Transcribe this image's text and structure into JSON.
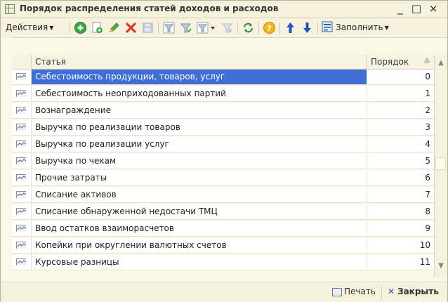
{
  "window": {
    "title": "Порядок распределения статей доходов и расходов",
    "minimize": "_",
    "maximize": "□",
    "close": "×"
  },
  "toolbar": {
    "actions_label": "Действия",
    "fill_label": "Заполнить"
  },
  "table": {
    "headers": {
      "name": "Статья",
      "order": "Порядок"
    },
    "sort_indicator": "≙",
    "rows": [
      {
        "name": "Себестоимость продукции, товаров, услуг",
        "order": "0",
        "selected": true
      },
      {
        "name": "Себестоимость неоприходованных партий",
        "order": "1"
      },
      {
        "name": "Вознаграждение",
        "order": "2"
      },
      {
        "name": "Выручка по реализации товаров",
        "order": "3"
      },
      {
        "name": "Выручка по реализации услуг",
        "order": "4"
      },
      {
        "name": "Выручка по чекам",
        "order": "5"
      },
      {
        "name": "Прочие затраты",
        "order": "6"
      },
      {
        "name": "Списание активов",
        "order": "7"
      },
      {
        "name": "Списание обнаруженной недостачи ТМЦ",
        "order": "8"
      },
      {
        "name": "Ввод остатков взаиморасчетов",
        "order": "9"
      },
      {
        "name": "Копейки при округлении валютных счетов",
        "order": "10"
      },
      {
        "name": "Курсовые разницы",
        "order": "11"
      }
    ]
  },
  "footer": {
    "print_label": "Печать",
    "close_label": "Закрыть"
  },
  "colors": {
    "selection": "#3f6fd4",
    "background": "#fbf7e7",
    "toolbar": "#f7f2dd"
  },
  "icons": [
    "add-icon",
    "copy-icon",
    "edit-icon",
    "delete-icon",
    "save-icon",
    "filter-icon",
    "refresh-icon",
    "help-icon",
    "move-up-icon",
    "move-down-icon",
    "fill-icon",
    "print-icon",
    "close-icon"
  ]
}
